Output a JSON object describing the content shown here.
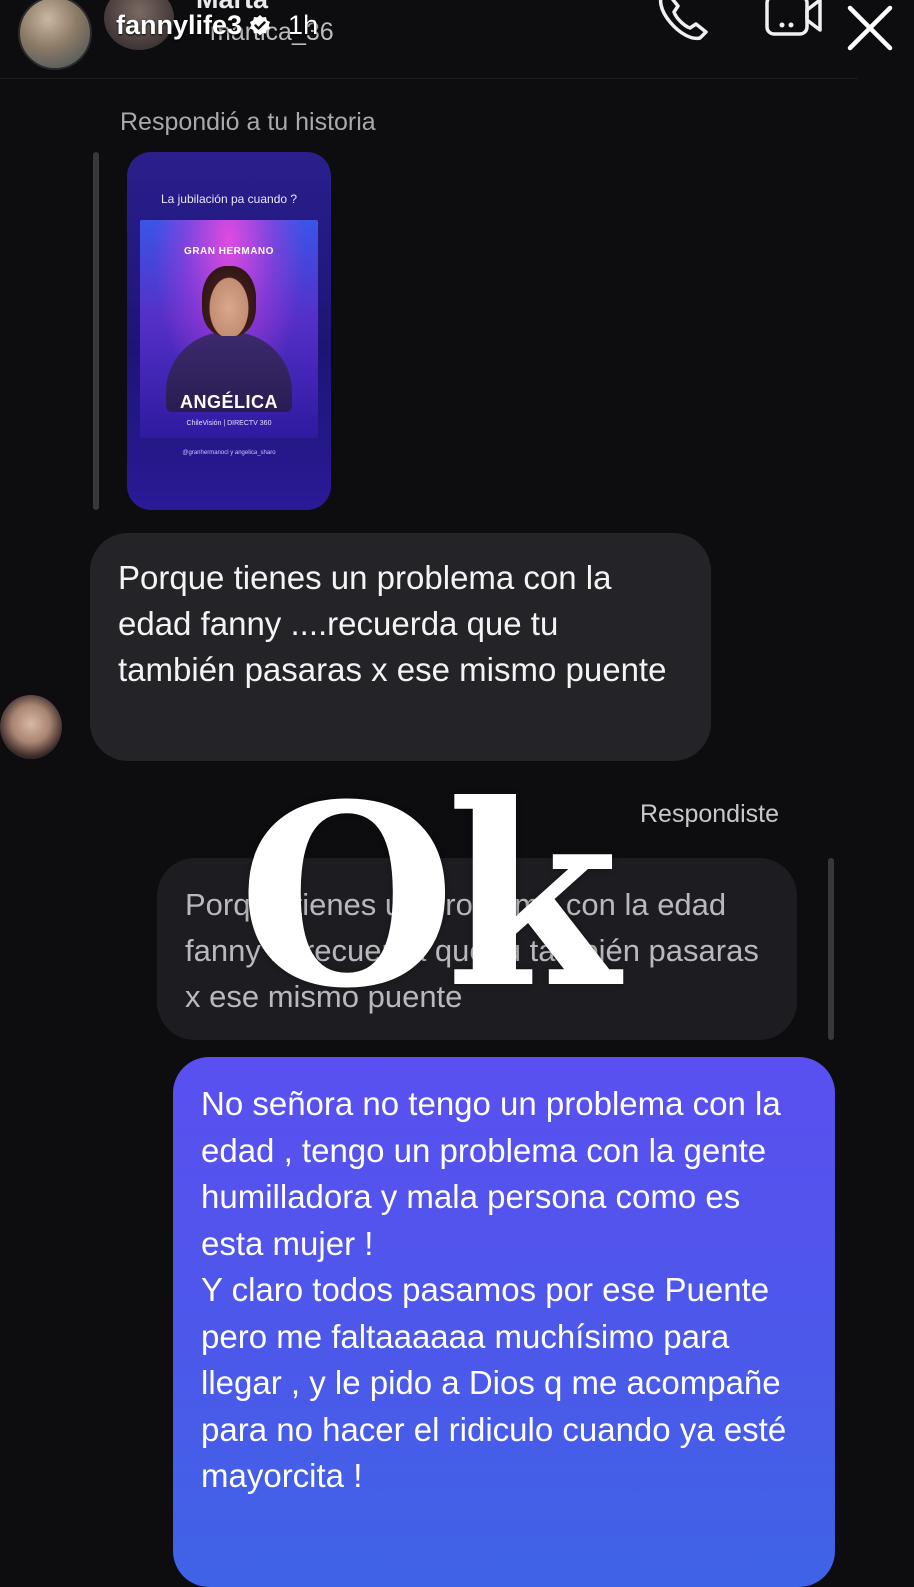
{
  "header": {
    "contact_name": "Marta",
    "contact_handle": "martica_36",
    "story_owner": "fannylife3",
    "story_time": "1h"
  },
  "icons": {
    "call": "phone-icon",
    "video": "video-call-icon",
    "close": "close-icon",
    "verified": "verified-badge-icon"
  },
  "story_reply": {
    "context_label": "Respondió a tu historia",
    "thumbnail": {
      "caption": "La jubilación pa cuando ?",
      "show": "GRAN HERMANO",
      "name": "ANGÉLICA",
      "network": "ChileVisión | DIRECTV 360",
      "credit": "@granhermanocl y angelica_sharo"
    }
  },
  "incoming_message": {
    "text": "Porque tienes un problema con la edad fanny ....recuerda que tu también pasaras x ese mismo puente"
  },
  "outgoing": {
    "reply_label": "Respondiste",
    "quoted_text": "Porque tienes un problema con la edad fanny ....recuerda que tu también pasaras x ese mismo puente",
    "sticker_text": "Ok",
    "message": "No señora no tengo un problema con la edad , tengo un problema con la gente humilladora y mala persona como es esta mujer !\nY claro todos pasamos por ese Puente pero me faltaaaaaa muchísimo para llegar , y le pido a Dios q me acompañe para no hacer el ridiculo cuando ya esté mayorcita !"
  },
  "colors": {
    "background": "#0d0d10",
    "incoming_bubble": "#242428",
    "outgoing_bubble_top": "#5a4ff0",
    "outgoing_bubble_bottom": "#3f63e6"
  }
}
